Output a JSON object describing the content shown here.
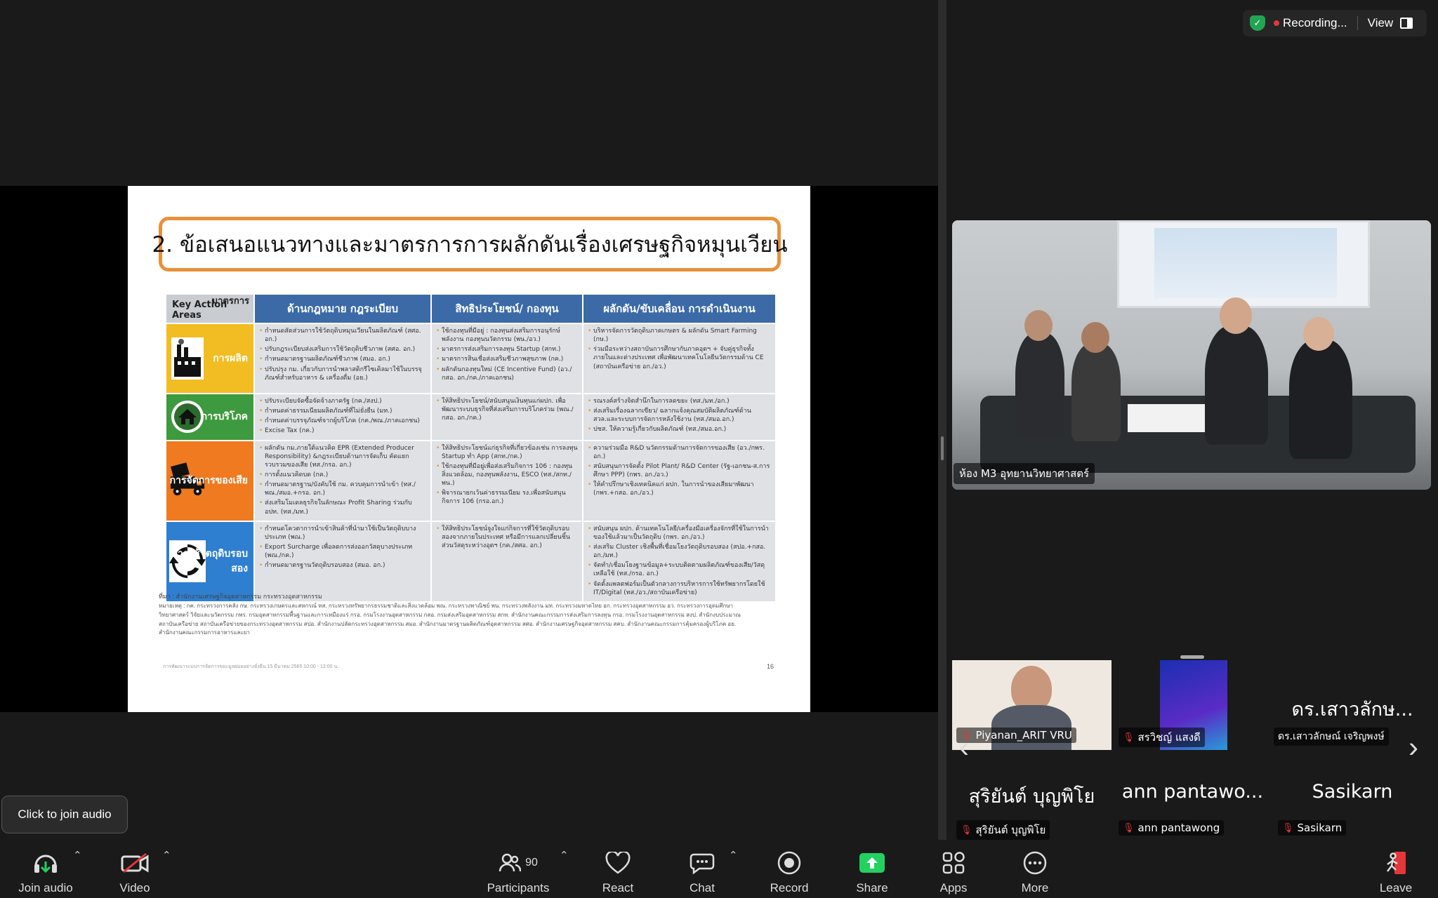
{
  "status": {
    "recording_label": "Recording...",
    "view_label": "View"
  },
  "slide": {
    "title": "2. ข้อเสนอแนวทางและมาตรการการผลักดันเรื่องเศรษฐกิจหมุนเวียน",
    "corner_top": "มาตรการ",
    "corner_bottom": "Key Action Areas",
    "headers": [
      "ด้านกฎหมาย กฎระเบียบ",
      "สิทธิประโยชน์/ กองทุน",
      "ผลักดัน/ขับเคลื่อน การดำเนินงาน"
    ],
    "rows": [
      {
        "area": "การผลิต",
        "law": [
          "กำหนดสัดส่วนการใช้วัตถุดิบหมุนเวียนในผลิตภัณฑ์ (สศอ. อก.)",
          "ปรับกฎระเบียบส่งเสริมการใช้วัตถุดิบชีวภาพ (สศอ. อก.)",
          "กำหนดมาตรฐานผลิตภัณฑ์ชีวภาพ (สมอ. อก.)",
          "ปรับปรุง กม. เกี่ยวกับการนำพลาสติกรีไซเคิลมาใช้ในบรรจุภัณฑ์สำหรับอาหาร & เครื่องดื่ม (อย.)"
        ],
        "fund": [
          "ใช้กองทุนที่มีอยู่ : กองทุนส่งเสริมการอนุรักษ์พลังงาน กองทุนนวัตกรรม (พน./อว.)",
          "มาตรการส่งเสริมการลงทุน Startup (สกท.)",
          "มาตรการสินเชื่อส่งเสริมชีวภาพสุขภาพ (กค.)",
          "ผลักดันกองทุนใหม่ (CE Incentive Fund) (อว./กสอ. อก./กค./ภาคเอกชน)"
        ],
        "drive": [
          "บริหารจัดการวัตถุดิบภาคเกษตร & ผลักดัน Smart Farming (กษ.)",
          "ร่วมมือระหว่างสถาบันการศึกษากับภาคอุตฯ + จับคู่ธุรกิจทั้งภายในและต่างประเทศ เพื่อพัฒนาเทคโนโลยีนวัตกรรมด้าน CE (สถาบันเครือข่าย อก./อว.)"
        ]
      },
      {
        "area": "การบริโภค",
        "law": [
          "ปรับระเบียบจัดซื้อจัดจ้างภาครัฐ (กค./สงป.)",
          "กำหนดค่าธรรมเนียมผลิตภัณฑ์ที่ไม่ยั่งยืน (มท.)",
          "กำหนดค่าบรรจุภัณฑ์จากผู้บริโภค (กค./พณ./ภาคเอกชน)",
          "Excise Tax (กค.)"
        ],
        "fund": [
          "ให้สิทธิประโยชน์/สนับสนุนเงินทุนแก่ผปก. เพื่อพัฒนาระบบธุรกิจที่ส่งเสริมการบริโภคร่วม (พณ./กสอ. อก./กค.)"
        ],
        "drive": [
          "รณรงค์สร้างจิตสำนึกในการลดขยะ (ทส./มท./อก.)",
          "ส่งเสริมเรื่องฉลากเขียว/ ฉลากแจ้งคุณสมบัติผลิตภัณฑ์ด้าน สวล.และระบบการจัดการหลังใช้งาน (ทส./สมอ.อก.)",
          "ปชส. ให้ความรู้เกี่ยวกับผลิตภัณฑ์ (ทส./สมอ.อก.)"
        ]
      },
      {
        "area": "การจัดการของเสีย",
        "law": [
          "ผลักดัน กม.ภายใต้แนวคิด EPR (Extended Producer Responsibility) &กฎระเบียบด้านการจัดเก็บ คัดแยก รวบรวมของเสีย (ทส./กรอ. อก.)",
          "การตั้งแนวคิดบด (กค.)",
          "กำหนดมาตรฐาน/บังคับใช้ กม. ควบคุมการนำเข้า (ทส./พณ./สมอ.+กรอ. อก.)",
          "ส่งเสริมโมเดลธุรกิจในลักษณะ Profit Sharing ร่วมกับ อปท. (ทส./มท.)"
        ],
        "fund": [
          "ให้สิทธิประโยชน์แก่ธุรกิจที่เกี่ยวข้องเช่น การลงทุน Startup ทำ App (สกท./กค.)",
          "ใช้กองทุนที่มีอยู่เพื่อส่งเสริมกิจการ 106 : กองทุนสิ่งแวดล้อม, กองทุนพลังงาน, ESCO (ทส./สกท./พน.)",
          "พิจารณายกเว้นค่าธรรมเนียม รง.เพื่อสนับสนุนกิจการ 106 (กรอ.อก.)"
        ],
        "drive": [
          "ความร่วมมือ R&D นวัตกรรมด้านการจัดการของเสีย (อว./กพร. อก.)",
          "สนับสนุนการจัดตั้ง Pilot Plant/ R&D Center (รัฐ-เอกชน-ส.การศึกษา PPP) (กพร. อก./อว.)",
          "ให้คำปรึกษาเชิงเทคนิคแก่ ผปก. ในการนำของเสียมาพัฒนา (กพร.+กสอ. อก./อว.)"
        ]
      },
      {
        "area": "การใช้วัตถุดิบรอบสอง",
        "law": [
          "กำหนดโควตาการนำเข้าสินค้าที่นำมาใช้เป็นวัตถุดิบบางประเภท (พณ.)",
          "Export Surcharge เพื่อลดการส่งออกวัสดุบางประเภท (พณ./กค.)",
          "กำหนดมาตรฐานวัตถุดิบรอบสอง (สมอ. อก.)"
        ],
        "fund": [
          "ให้สิทธิประโยชน์จูงใจแก่กิจการที่ใช้วัตถุดิบรอบสองจากภายในประเทศ หรือมีการแลกเปลี่ยนชิ้นส่วนวัสดุระหว่างอุตฯ (กค./สศอ. อก.)"
        ],
        "drive": [
          "สนับสนุน ผปก. ด้านเทคโนโลยี/เครื่องมือเครื่องจักรที่ใช้ในการนำของใช้แล้วมาเป็นวัตถุดิบ (กพร. อก./อว.)",
          "ส่งเสริม Cluster เชิงพื้นที่เชื่อมโยงวัตถุดิบรอบสอง (สปอ.+กสอ. อก./มท.)",
          "จัดทำ/เชื่อมโยงฐานข้อมูล+ระบบติดตามผลิตภัณฑ์ของเสีย/วัสดุเหลือใช้ (ทส./กรอ. อก.)",
          "จัดตั้งแพลตฟอร์มเป็นตัวกลางการบริหารการใช้ทรัพยากรโดยใช้ IT/Digital (ทส./อว./สถาบันเครือข่าย)"
        ]
      }
    ],
    "source": "ที่มา : สำนักงานเศรษฐกิจอุตสาหกรรม กระทรวงอุตสาหกรรม",
    "note": "หมายเหตุ : กค. กระทรวงการคลัง กษ. กระทรวงเกษตรและสหกรณ์ ทส. กระทรวงทรัพยากรธรรมชาติและสิ่งแวดล้อม พณ. กระทรวงพาณิชย์ พน. กระทรวงพลังงาน มท. กระทรวงมหาดไทย อก. กระทรวงอุตสาหกรรม อว. กระทรวงการอุดมศึกษา วิทยาศาสตร์ วิจัยและนวัตกรรม กพร. กรมอุตสาหกรรมพื้นฐานและการเหมืองแร่ กรอ. กรมโรงงานอุตสาหกรรม กสอ. กรมส่งเสริมอุตสาหกรรม สกท. สำนักงานคณะกรรมการส่งเสริมการลงทุน กรอ. กรมโรงงานอุตสาหกรรม สงป. สำนักงบประมาณ สถาบันเครือข่าย สถาบันเครือข่ายของกระทรวงอุตสาหกรรม สปอ. สำนักงานปลัดกระทรวงอุตสาหกรรม สมอ. สำนักงานมาตรฐานผลิตภัณฑ์อุตสาหกรรม สศอ. สำนักงานเศรษฐกิจอุตสาหกรรม สคบ. สำนักงานคณะกรรมการคุ้มครองผู้บริโภค อย. สำนักงานคณะกรรมการอาหารและยา",
    "footer": "การพัฒนาระบบการจัดการขยะมูลฝอยอย่างยั่งยืน 15 มีนาคม 2565 10:00 - 12:00 น.",
    "page_number": "16"
  },
  "speaker": {
    "label": "ห้อง M3 อุทยานวิทยาศาสตร์"
  },
  "gallery": {
    "tiles": [
      {
        "name": "Piyanan_ARIT VRU",
        "muted": true
      },
      {
        "name": "สรวิชญ์   แสงดี",
        "muted": true
      },
      {
        "display": "ดร.เสาวลักษ...",
        "name": "ดร.เสาวลักษณ์ เจริญพงษ์",
        "muted": false
      },
      {
        "display": "สุริยันต์ บุญพิโย",
        "name": "สุริยันต์ บุญพิโย",
        "muted": true
      },
      {
        "display": "ann pantawo...",
        "name": "ann pantawong",
        "muted": true
      },
      {
        "display": "Sasikarn",
        "name": "Sasikarn",
        "muted": true
      }
    ]
  },
  "tooltip": "Click to join audio",
  "toolbar": {
    "join_audio": "Join audio",
    "video": "Video",
    "participants": "Participants",
    "participants_count": "90",
    "react": "React",
    "chat": "Chat",
    "record": "Record",
    "share": "Share",
    "apps": "Apps",
    "more": "More",
    "leave": "Leave"
  },
  "colors": {
    "background": "#1a1a1a",
    "share_green": "#23d160",
    "leave_red": "#e4373a",
    "slide_header_blue": "#3b6aa7",
    "title_border_orange": "#e8913a"
  }
}
